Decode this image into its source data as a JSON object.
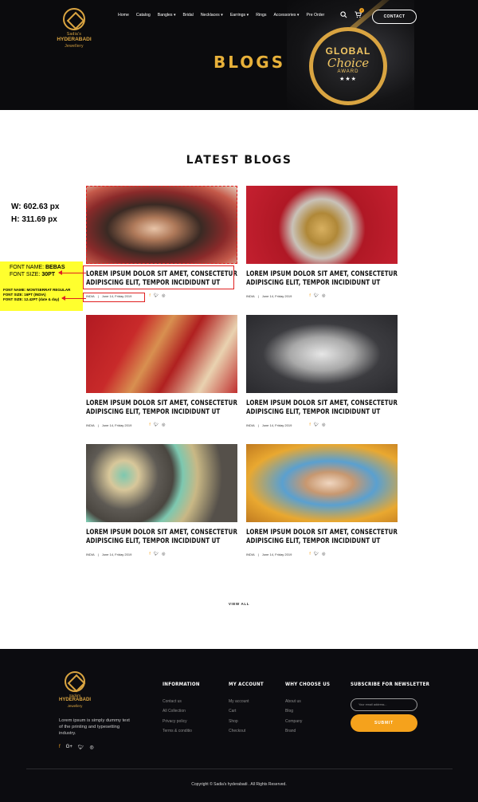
{
  "header": {
    "logo_small": "Sadia's",
    "logo_big": "HYDERABADI",
    "logo_tag": "Jewellery",
    "nav": [
      "Home",
      "Catalog",
      "Bangles",
      "Bridal",
      "Necklaces",
      "Earrings",
      "Rings",
      "Accessories",
      "Pre Order"
    ],
    "cart_count": "2",
    "contact_label": "CONTACT",
    "page_title": "BLOGS",
    "award_line1": "GLOBAL",
    "award_line2": "Choice",
    "award_line3": "AWARD",
    "award_stars": "★★★"
  },
  "section_title": "LATEST BLOGS",
  "annotation": {
    "width": "W: 602.63 px",
    "height": "H: 311.69 px",
    "font_name_label": "FONT NAME: ",
    "font_name_value": "BEBAS",
    "font_size_label": "FONT SIZE: ",
    "font_size_value": "30PT",
    "small_font_name": "FONT NAME: MONTSERRAT REGULAR",
    "small_font_size1": "FONT SIZE: 16PT (INDIA)",
    "small_font_size2": "FONT SIZE: 12.42PT (date & day)"
  },
  "posts": [
    {
      "title": "LOREM IPSUM DOLOR SIT AMET, CONSECTETUR ADIPISCING ELIT, TEMPOR INCIDIDUNT UT",
      "country": "INDIA",
      "date": "June 14, Friday 2019"
    },
    {
      "title": "LOREM IPSUM DOLOR SIT AMET, CONSECTETUR ADIPISCING ELIT, TEMPOR INCIDIDUNT UT",
      "country": "INDIA",
      "date": "June 14, Friday 2019"
    },
    {
      "title": "LOREM IPSUM DOLOR SIT AMET, CONSECTETUR ADIPISCING ELIT, TEMPOR INCIDIDUNT UT",
      "country": "INDIA",
      "date": "June 14, Friday 2019"
    },
    {
      "title": "LOREM IPSUM DOLOR SIT AMET, CONSECTETUR ADIPISCING ELIT, TEMPOR INCIDIDUNT UT",
      "country": "INDIA",
      "date": "June 14, Friday 2019"
    },
    {
      "title": "LOREM IPSUM DOLOR SIT AMET, CONSECTETUR ADIPISCING ELIT, TEMPOR INCIDIDUNT UT",
      "country": "INDIA",
      "date": "June 14, Friday 2019"
    },
    {
      "title": "LOREM IPSUM DOLOR SIT AMET, CONSECTETUR ADIPISCING ELIT, TEMPOR INCIDIDUNT UT",
      "country": "INDIA",
      "date": "June 14, Friday 2019"
    }
  ],
  "view_all": "VIEW ALL",
  "footer": {
    "description": "Lorem ipsum is simply dummy text of the printing and typesetting industry.",
    "columns": [
      {
        "heading": "INFORMATION",
        "links": [
          "Contact us",
          "All Collection",
          "Privacy policy",
          "Terms & conditio"
        ]
      },
      {
        "heading": "MY ACCOUNT",
        "links": [
          "My account",
          "Cart",
          "Shop",
          "Checkout"
        ]
      },
      {
        "heading": "WHY CHOOSE US",
        "links": [
          "About us",
          "Blog",
          "Company",
          "Brand"
        ]
      }
    ],
    "newsletter_heading": "SUBSCRIBE FOR NEWSLETTER",
    "email_placeholder": "Your email address...",
    "submit_label": "SUBMIT",
    "copyright": "Copyright © Sadia's hyderabadi . All Rights Reserved."
  }
}
